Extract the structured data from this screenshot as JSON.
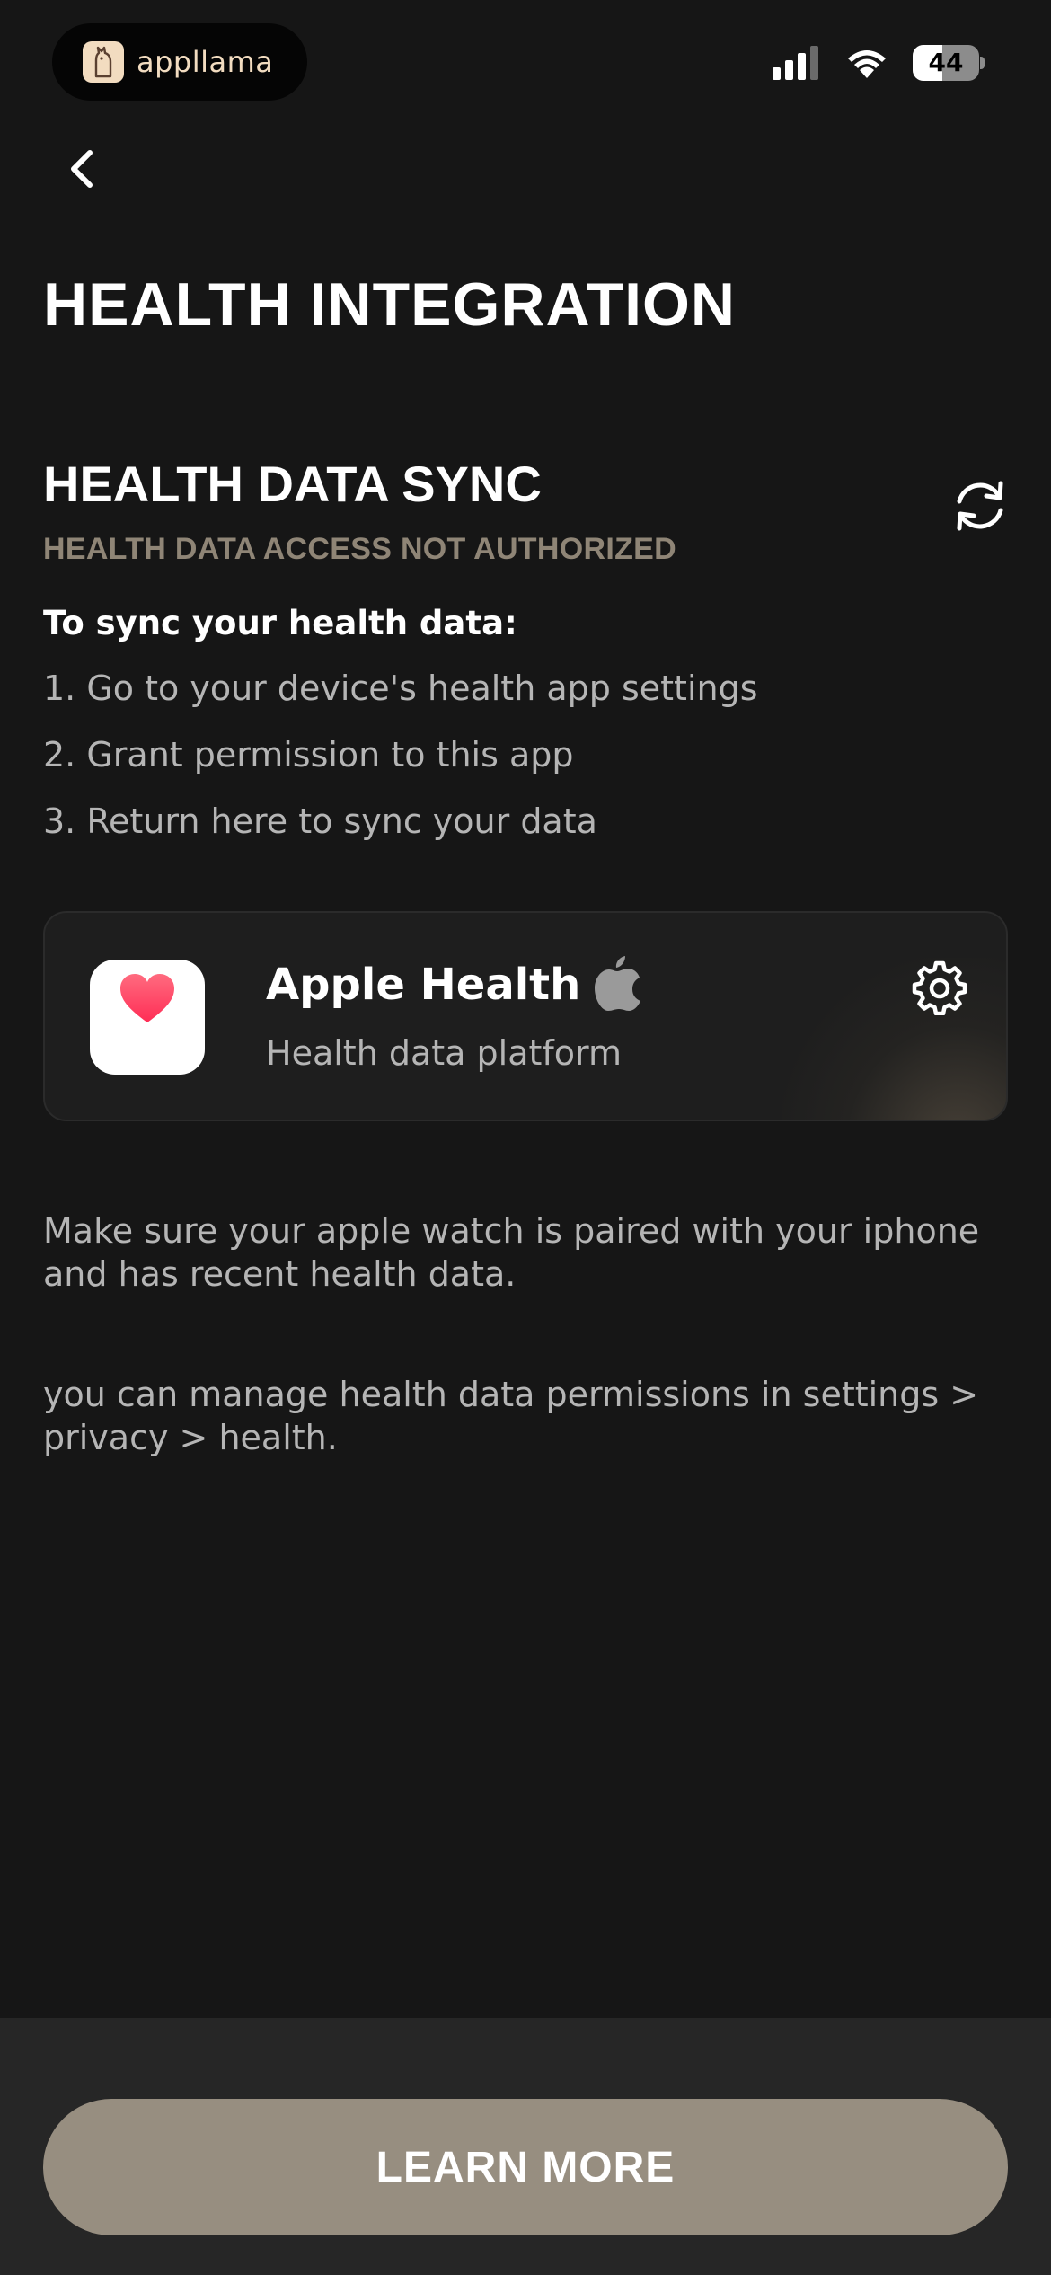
{
  "status_bar": {
    "app_name": "appllama",
    "battery_level": "44",
    "battery_fraction": 0.44
  },
  "header": {
    "title": "HEALTH INTEGRATION"
  },
  "sync_section": {
    "title": "HEALTH DATA SYNC",
    "status": "HEALTH DATA ACCESS NOT AUTHORIZED",
    "steps_heading": "To sync your health data:",
    "steps": [
      "1. Go to your device's health app settings",
      "2. Grant permission to this app",
      "3. Return here to sync your data"
    ]
  },
  "health_card": {
    "title": "Apple Health",
    "subtitle": "Health data platform"
  },
  "notes": [
    "Make sure your apple watch is paired with your iphone and has recent health data.",
    "you can manage health data permissions in settings > privacy > health."
  ],
  "footer": {
    "button_label": "LEARN MORE"
  },
  "colors": {
    "background": "#161616",
    "accent": "#978e80",
    "warning_text": "#8f8576",
    "heart": "#ff3b5c"
  },
  "icons": {
    "back": "chevron-left-icon",
    "refresh": "refresh-icon",
    "settings": "gear-icon",
    "apple": "apple-logo-icon",
    "heart": "heart-icon"
  }
}
